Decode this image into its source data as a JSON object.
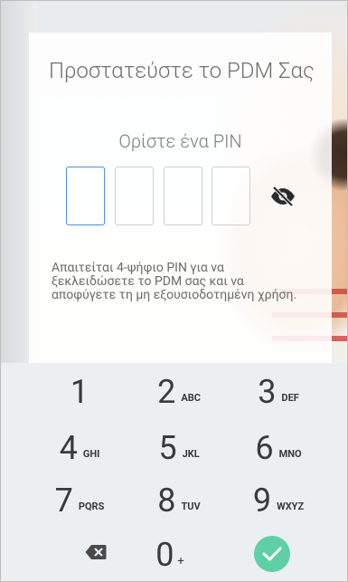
{
  "setup": {
    "title": "Προστατεύστε το PDM Σας",
    "subtitle": "Ορίστε ένα PIN",
    "pin_length": 4,
    "info": "Απαιτείται 4-ψήφιο PIN για να ξεκλειδώσετε το PDM σας και να αποφύγετε τη μη εξουσιοδοτημένη χρήση."
  },
  "keypad": {
    "keys": [
      {
        "num": "1",
        "letters": ""
      },
      {
        "num": "2",
        "letters": "ABC"
      },
      {
        "num": "3",
        "letters": "DEF"
      },
      {
        "num": "4",
        "letters": "GHI"
      },
      {
        "num": "5",
        "letters": "JKL"
      },
      {
        "num": "6",
        "letters": "MNO"
      },
      {
        "num": "7",
        "letters": "PQRS"
      },
      {
        "num": "8",
        "letters": "TUV"
      },
      {
        "num": "9",
        "letters": "WXYZ"
      }
    ],
    "zero": {
      "num": "0",
      "extra": "+"
    },
    "backspace_icon": "backspace-icon",
    "confirm_icon": "check-icon"
  },
  "colors": {
    "confirm": "#5ecfa6",
    "active_pin_border": "#4a90d9",
    "keypad_bg": "#eceff1"
  }
}
